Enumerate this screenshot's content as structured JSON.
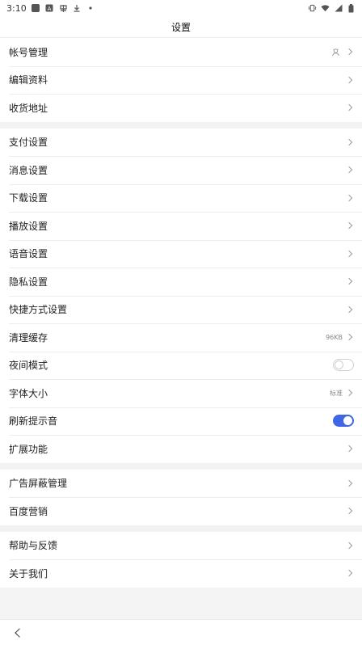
{
  "status_bar": {
    "time": "3:10",
    "left_icons": [
      "app-icon",
      "notification-a-icon",
      "chinese-app-icon",
      "download-icon",
      "dot-icon"
    ],
    "right_icons": [
      "vibrate-icon",
      "wifi-icon",
      "signal-icon",
      "battery-icon"
    ]
  },
  "header": {
    "title": "设置"
  },
  "groups": [
    {
      "items": [
        {
          "label": "帐号管理",
          "value": "",
          "trailing_icon": "avatar-icon"
        },
        {
          "label": "编辑资料",
          "value": ""
        },
        {
          "label": "收货地址",
          "value": ""
        }
      ]
    },
    {
      "items": [
        {
          "label": "支付设置",
          "value": ""
        },
        {
          "label": "消息设置",
          "value": ""
        },
        {
          "label": "下载设置",
          "value": ""
        },
        {
          "label": "播放设置",
          "value": ""
        },
        {
          "label": "语音设置",
          "value": ""
        },
        {
          "label": "隐私设置",
          "value": ""
        },
        {
          "label": "快捷方式设置",
          "value": ""
        },
        {
          "label": "清理缓存",
          "value": "96KB"
        },
        {
          "label": "夜间模式",
          "toggle": false
        },
        {
          "label": "字体大小",
          "value": "标准"
        },
        {
          "label": "刷新提示音",
          "toggle": true
        },
        {
          "label": "扩展功能",
          "value": ""
        }
      ]
    },
    {
      "items": [
        {
          "label": "广告屏蔽管理",
          "value": ""
        },
        {
          "label": "百度营销",
          "value": ""
        }
      ]
    },
    {
      "items": [
        {
          "label": "帮助与反馈",
          "value": ""
        },
        {
          "label": "关于我们",
          "value": ""
        }
      ]
    }
  ],
  "colors": {
    "toggle_on": "#3f66e6",
    "background": "#f4f4f4"
  },
  "bottom_nav": {
    "back_icon": "back-arrow-icon"
  }
}
